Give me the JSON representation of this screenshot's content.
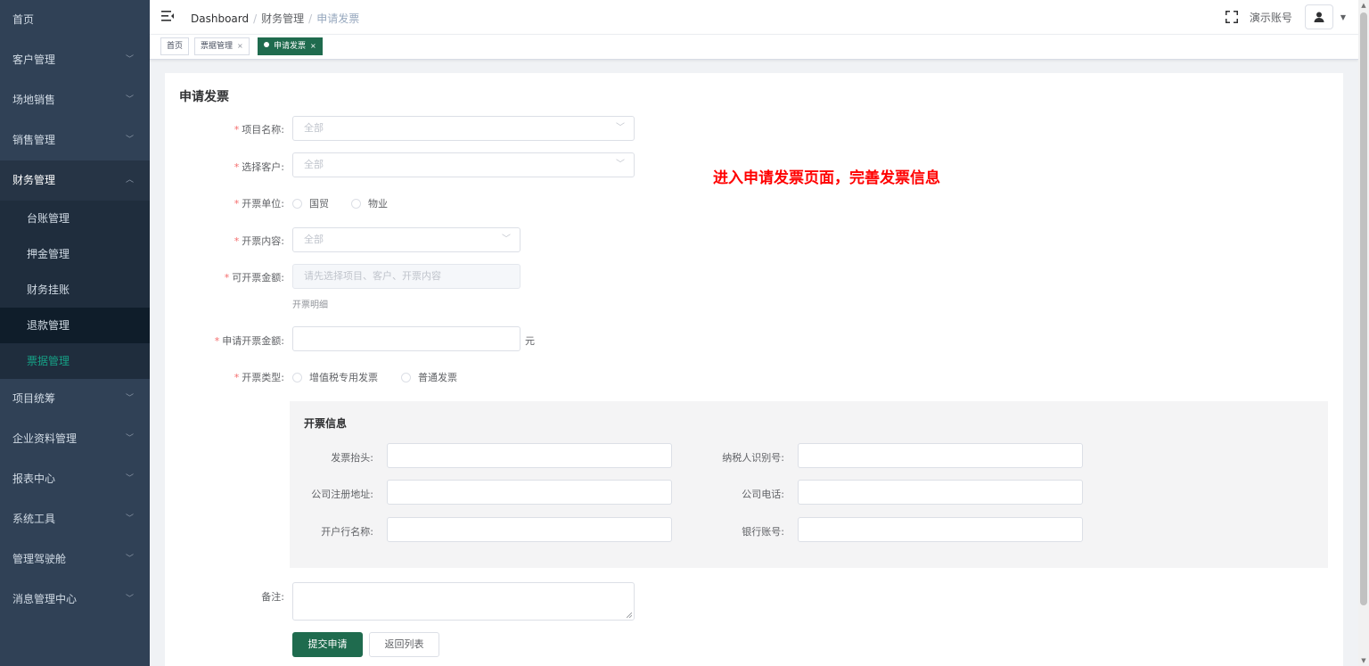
{
  "sidebar": {
    "items": [
      {
        "label": "首页"
      },
      {
        "label": "客户管理"
      },
      {
        "label": "场地销售"
      },
      {
        "label": "销售管理"
      },
      {
        "label": "财务管理"
      },
      {
        "label": "项目统筹"
      },
      {
        "label": "企业资料管理"
      },
      {
        "label": "报表中心"
      },
      {
        "label": "系统工具"
      },
      {
        "label": "管理驾驶舱"
      },
      {
        "label": "消息管理中心"
      }
    ],
    "finance_sub": [
      {
        "label": "台账管理"
      },
      {
        "label": "押金管理"
      },
      {
        "label": "财务挂账"
      },
      {
        "label": "退款管理"
      },
      {
        "label": "票据管理"
      }
    ],
    "active_color": "#16a085"
  },
  "header": {
    "breadcrumb": [
      "Dashboard",
      "财务管理",
      "申请发票"
    ],
    "separator": "/",
    "account_name": "演示账号"
  },
  "tags": [
    {
      "label": "首页"
    },
    {
      "label": "票据管理",
      "close": "×"
    },
    {
      "label": "申请发票",
      "close": "×"
    }
  ],
  "form": {
    "title": "申请发票",
    "required_mark": "*",
    "project": {
      "label": "项目名称:",
      "value": "全部"
    },
    "customer": {
      "label": "选择客户:",
      "value": "全部"
    },
    "unit": {
      "label": "开票单位:",
      "options": [
        "国贸",
        "物业"
      ]
    },
    "content": {
      "label": "开票内容:",
      "value": "全部"
    },
    "available_amount": {
      "label": "可开票金额:",
      "placeholder": "请先选择项目、客户、开票内容",
      "hint": "开票明细"
    },
    "apply_amount": {
      "label": "申请开票金额:",
      "value": "",
      "unit": "元"
    },
    "invoice_type": {
      "label": "开票类型:",
      "options": [
        "增值税专用发票",
        "普通发票"
      ]
    },
    "remark": {
      "label": "备注:"
    },
    "submit_label": "提交申请",
    "back_label": "返回列表",
    "primary_color": "#1f6b4e"
  },
  "invoice_info": {
    "title": "开票信息",
    "fields": [
      {
        "label": "发票抬头:"
      },
      {
        "label": "纳税人识别号:"
      },
      {
        "label": "公司注册地址:"
      },
      {
        "label": "公司电话:"
      },
      {
        "label": "开户行名称:"
      },
      {
        "label": "银行账号:"
      }
    ]
  },
  "annotation": "进入申请发票页面，完善发票信息"
}
